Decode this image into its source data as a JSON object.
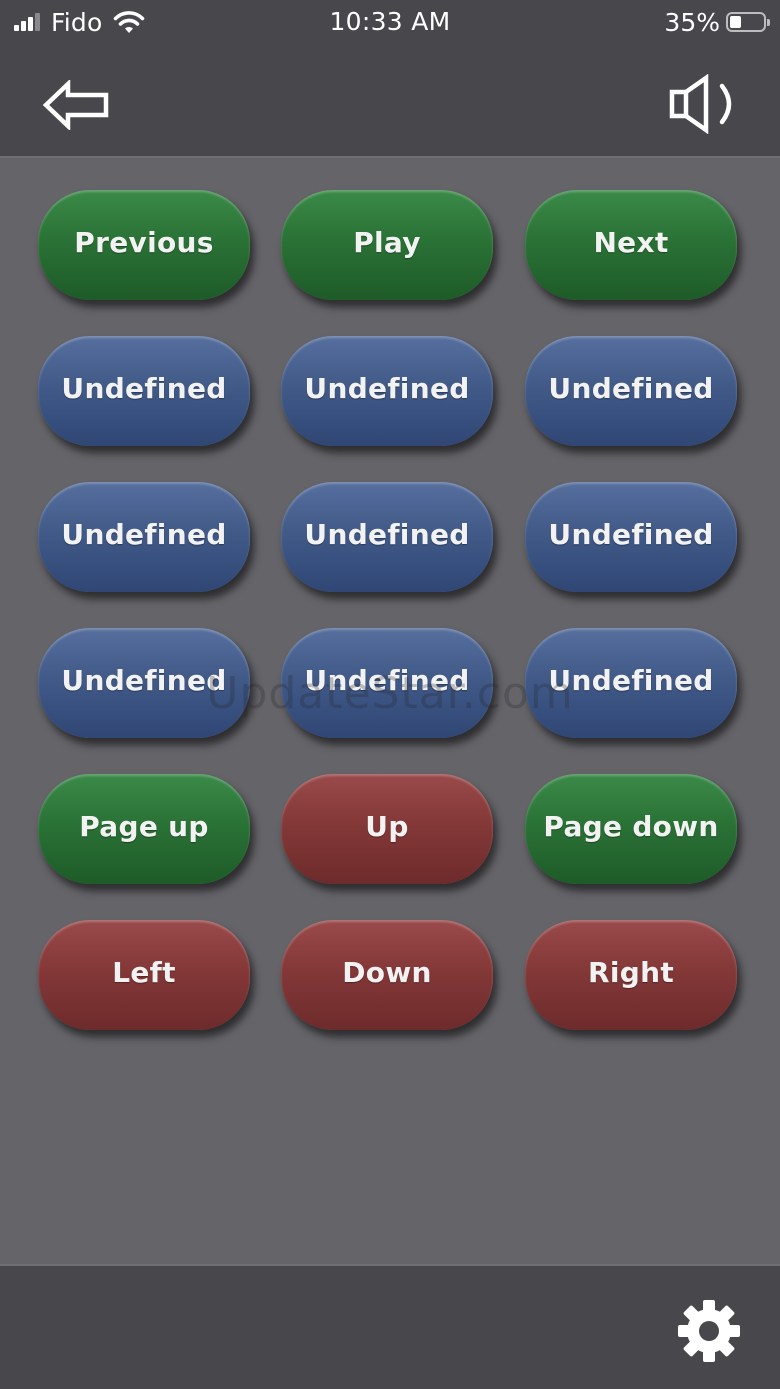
{
  "status_bar": {
    "carrier": "Fido",
    "time": "10:33 AM",
    "battery_percent": "35%",
    "battery_level": 0.35,
    "signal_bars": 3,
    "signal_bars_total": 4,
    "icons": [
      "signal-icon",
      "wifi-icon",
      "battery-icon"
    ]
  },
  "nav": {
    "back_icon": "back-arrow-icon",
    "sound_icon": "speaker-icon"
  },
  "buttons": [
    {
      "label": "Previous",
      "color": "green"
    },
    {
      "label": "Play",
      "color": "green"
    },
    {
      "label": "Next",
      "color": "green"
    },
    {
      "label": "Undefined",
      "color": "blue"
    },
    {
      "label": "Undefined",
      "color": "blue"
    },
    {
      "label": "Undefined",
      "color": "blue"
    },
    {
      "label": "Undefined",
      "color": "blue"
    },
    {
      "label": "Undefined",
      "color": "blue"
    },
    {
      "label": "Undefined",
      "color": "blue"
    },
    {
      "label": "Undefined",
      "color": "blue"
    },
    {
      "label": "Undefined",
      "color": "blue"
    },
    {
      "label": "Undefined",
      "color": "blue"
    },
    {
      "label": "Page up",
      "color": "green"
    },
    {
      "label": "Up",
      "color": "red"
    },
    {
      "label": "Page down",
      "color": "green"
    },
    {
      "label": "Left",
      "color": "red"
    },
    {
      "label": "Down",
      "color": "red"
    },
    {
      "label": "Right",
      "color": "red"
    }
  ],
  "colors": {
    "green": "#2a7236",
    "blue": "#415a88",
    "red": "#843838",
    "background": "#646469",
    "bar": "#48484c"
  },
  "watermark": "UpdateStar.com",
  "bottom_bar": {
    "settings_icon": "gear-icon"
  }
}
